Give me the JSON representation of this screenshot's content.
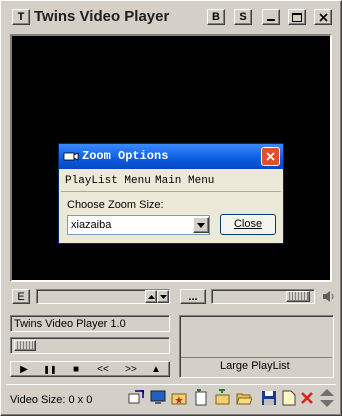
{
  "window": {
    "title": "Twins Video Player",
    "menu_btn": "T",
    "btn_b": "B",
    "btn_s": "S"
  },
  "dialog": {
    "title": "Zoom Options",
    "menu": [
      "PlayList Menu",
      "Main Menu"
    ],
    "zoom_label": "Choose Zoom Size:",
    "zoom_value": "xiazaiba",
    "close_label": "Close"
  },
  "controls": {
    "e_label": "E",
    "ellipsis": "...",
    "track_name": "Twins Video Player 1.0",
    "playlist_label": "Large PlayList",
    "transport": [
      "▶",
      "❚❚",
      "■",
      "<<",
      ">>",
      "▲"
    ]
  },
  "status": {
    "video_size": "Video Size: 0 x 0"
  },
  "colors": {
    "title_bar_start": "#3d8aff",
    "title_bar_end": "#0846c0",
    "close_red": "#e0502c"
  }
}
